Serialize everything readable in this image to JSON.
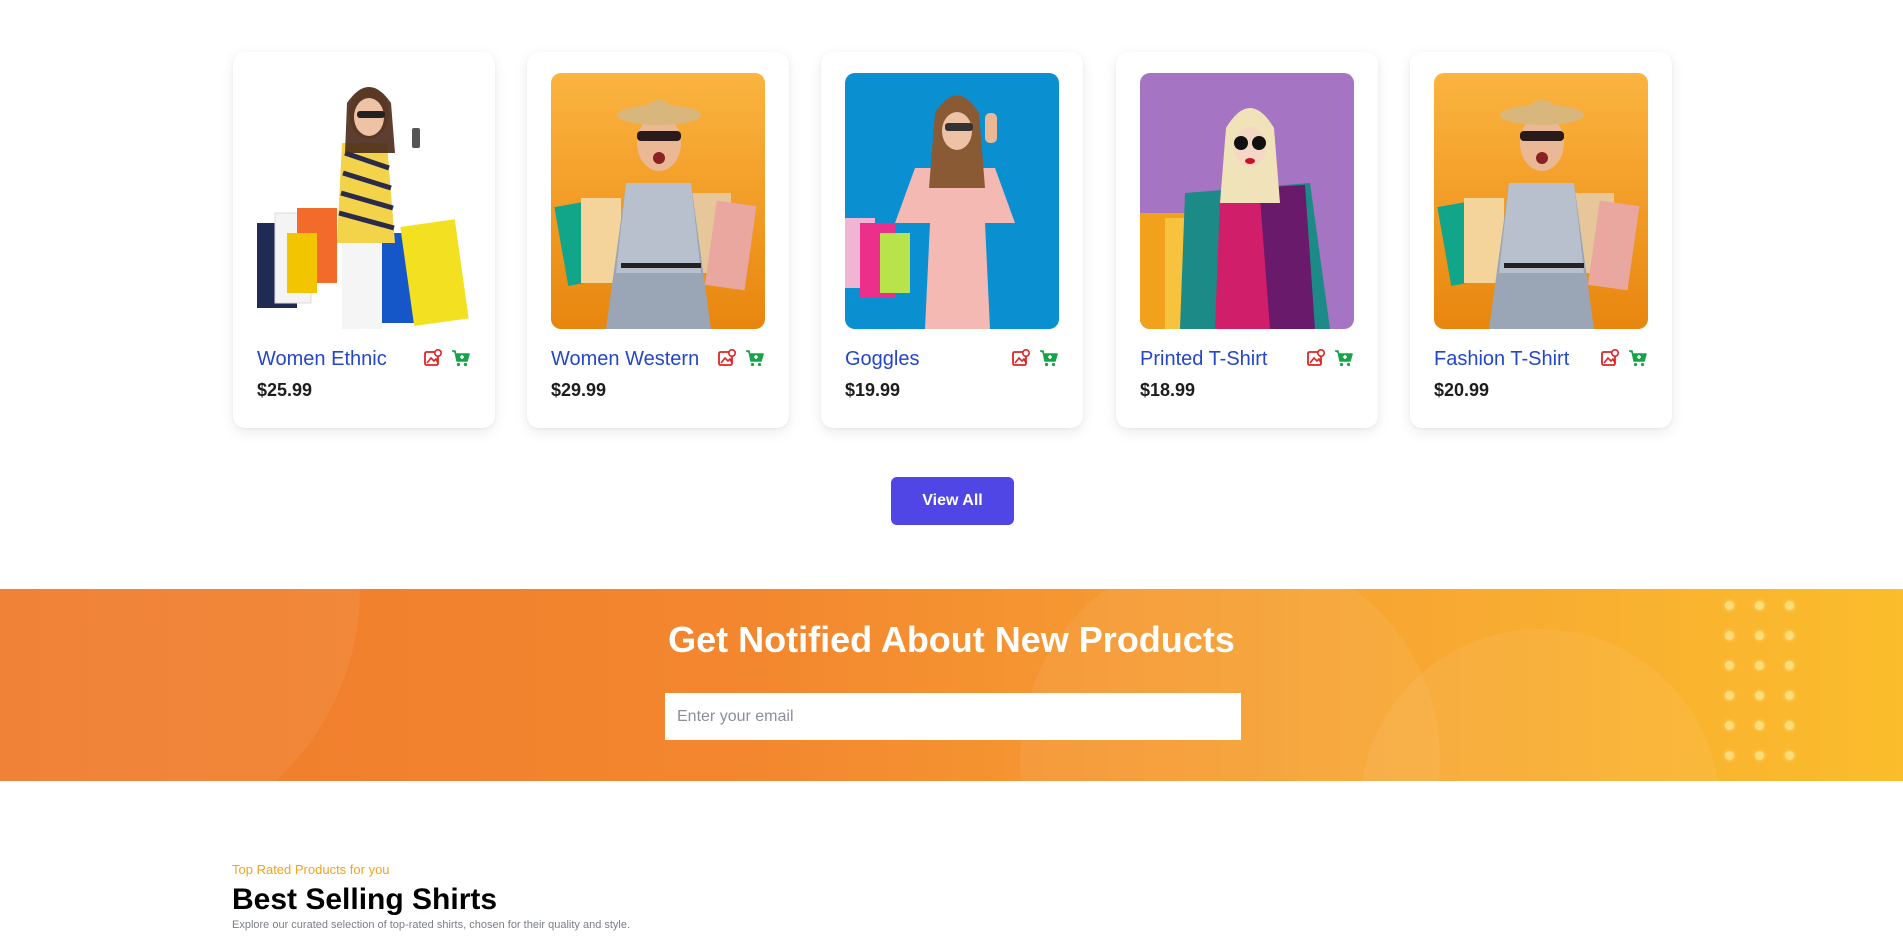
{
  "products": [
    {
      "name": "Women Ethnic",
      "price": "$25.99",
      "image": "woman-shopping-bags-white-bg"
    },
    {
      "name": "Women Western",
      "price": "$29.99",
      "image": "woman-shopping-bags-orange-bg"
    },
    {
      "name": "Goggles",
      "price": "$19.99",
      "image": "woman-pink-dress-blue-bg"
    },
    {
      "name": "Printed T-Shirt",
      "price": "$18.99",
      "image": "woman-sunglasses-purple-bg"
    },
    {
      "name": "Fashion T-Shirt",
      "price": "$20.99",
      "image": "woman-shopping-bags-orange-bg"
    }
  ],
  "icons": {
    "gallery": "image-icon",
    "cart": "cart-plus-icon"
  },
  "colors": {
    "accent": "#4f46e5",
    "name": "#2446c9",
    "gallery_icon": "#dc2626",
    "cart_icon": "#16a34a",
    "tag": "#f4a31b"
  },
  "view_all_label": "View All",
  "newsletter": {
    "heading": "Get Notified About New Products",
    "email_placeholder": "Enter your email"
  },
  "best_selling": {
    "tagline": "Top Rated Products for you",
    "title": "Best Selling Shirts",
    "description": "Explore our curated selection of top-rated shirts, chosen for their quality and style."
  }
}
